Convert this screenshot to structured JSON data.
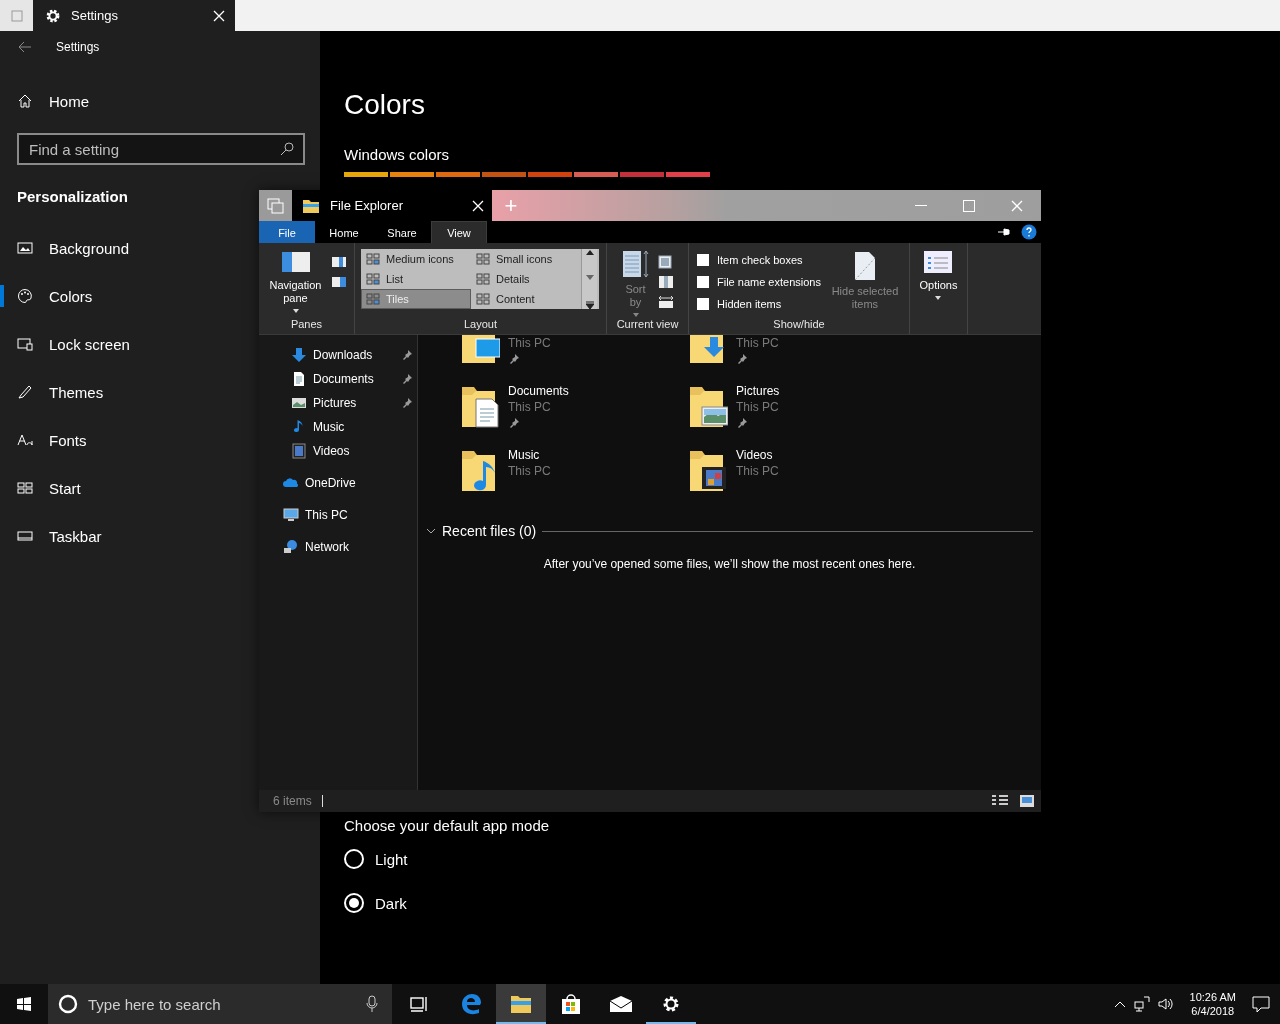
{
  "settings_window": {
    "tab_title": "Settings",
    "app_title": "Settings"
  },
  "sidebar": {
    "home": "Home",
    "search": {
      "placeholder": "Find a setting"
    },
    "section": "Personalization",
    "items": [
      {
        "label": "Background",
        "selected": false
      },
      {
        "label": "Colors",
        "selected": true
      },
      {
        "label": "Lock screen",
        "selected": false
      },
      {
        "label": "Themes",
        "selected": false
      },
      {
        "label": "Fonts",
        "selected": false
      },
      {
        "label": "Start",
        "selected": false
      },
      {
        "label": "Taskbar",
        "selected": false
      }
    ]
  },
  "page": {
    "title": "Colors",
    "windows_colors": {
      "heading": "Windows colors",
      "swatches": [
        {
          "color": "#e8a80c"
        },
        {
          "color": "#e8830e"
        },
        {
          "color": "#e06a12"
        },
        {
          "color": "#c45414"
        },
        {
          "color": "#d2430f"
        },
        {
          "color": "#d85d55"
        },
        {
          "color": "#c4313d"
        },
        {
          "color": "#e2404a"
        }
      ]
    },
    "app_mode": {
      "heading": "Choose your default app mode",
      "options": [
        {
          "label": "Light",
          "selected": false
        },
        {
          "label": "Dark",
          "selected": true
        }
      ]
    }
  },
  "explorer": {
    "tab_title": "File Explorer",
    "new_tab": "+",
    "ribbon_tabs": [
      {
        "label": "File",
        "kind": "file",
        "selected": false
      },
      {
        "label": "Home",
        "kind": "tab",
        "selected": false
      },
      {
        "label": "Share",
        "kind": "tab",
        "selected": false
      },
      {
        "label": "View",
        "kind": "tab",
        "selected": true
      }
    ],
    "ribbon": {
      "panes": {
        "label": "Panes",
        "navigation_pane": "Navigation pane"
      },
      "layout": {
        "label": "Layout",
        "options": [
          {
            "label": "Medium icons",
            "selected": false
          },
          {
            "label": "Small icons",
            "selected": false
          },
          {
            "label": "List",
            "selected": false
          },
          {
            "label": "Details",
            "selected": false
          },
          {
            "label": "Tiles",
            "selected": true
          },
          {
            "label": "Content",
            "selected": false
          }
        ]
      },
      "current_view": {
        "label": "Current view",
        "sort_by": {
          "label": "Sort by",
          "disabled": true
        }
      },
      "show_hide": {
        "label": "Show/hide",
        "checkboxes": [
          {
            "label": "Item check boxes",
            "checked": false
          },
          {
            "label": "File name extensions",
            "checked": false
          },
          {
            "label": "Hidden items",
            "checked": false
          }
        ],
        "hide_selected": {
          "label": "Hide selected items",
          "disabled": true
        }
      },
      "options": {
        "label": "Options"
      }
    },
    "nav_pane": [
      {
        "label": "Downloads",
        "kind": "downloads",
        "pinned": true
      },
      {
        "label": "Documents",
        "kind": "documents",
        "pinned": true
      },
      {
        "label": "Pictures",
        "kind": "pictures",
        "pinned": true
      },
      {
        "label": "Music",
        "kind": "music",
        "pinned": false
      },
      {
        "label": "Videos",
        "kind": "videos",
        "pinned": false
      },
      {
        "label": "OneDrive",
        "kind": "cloud",
        "pinned": false
      },
      {
        "label": "This PC",
        "kind": "computer",
        "pinned": false
      },
      {
        "label": "Network",
        "kind": "network",
        "pinned": false
      }
    ],
    "tiles": [
      {
        "kind": "desktop",
        "location": "This PC",
        "pinned": true
      },
      {
        "kind": "downloads",
        "location": "This PC",
        "pinned": true
      },
      {
        "kind": "documents",
        "name": "Documents",
        "location": "This PC",
        "pinned": true
      },
      {
        "kind": "pictures",
        "name": "Pictures",
        "location": "This PC",
        "pinned": true
      },
      {
        "kind": "music",
        "name": "Music",
        "location": "This PC",
        "pinned": false
      },
      {
        "kind": "videos",
        "name": "Videos",
        "location": "This PC",
        "pinned": false
      }
    ],
    "recent": {
      "heading": "Recent files (0)",
      "expanded": true,
      "message": "After you’ve opened some files, we’ll show the most recent ones here."
    },
    "status": "6 items"
  },
  "taskbar": {
    "search_placeholder": "Type here to search",
    "apps": [
      {
        "kind": "taskview",
        "running": false,
        "selected": false
      },
      {
        "kind": "edge",
        "running": false,
        "selected": false
      },
      {
        "kind": "explorer",
        "running": true,
        "selected": true
      },
      {
        "kind": "store",
        "running": false,
        "selected": false
      },
      {
        "kind": "mail",
        "running": false,
        "selected": false
      },
      {
        "kind": "settings",
        "running": true,
        "selected": false
      }
    ],
    "time": "10:26 AM",
    "date": "6/4/2018"
  }
}
